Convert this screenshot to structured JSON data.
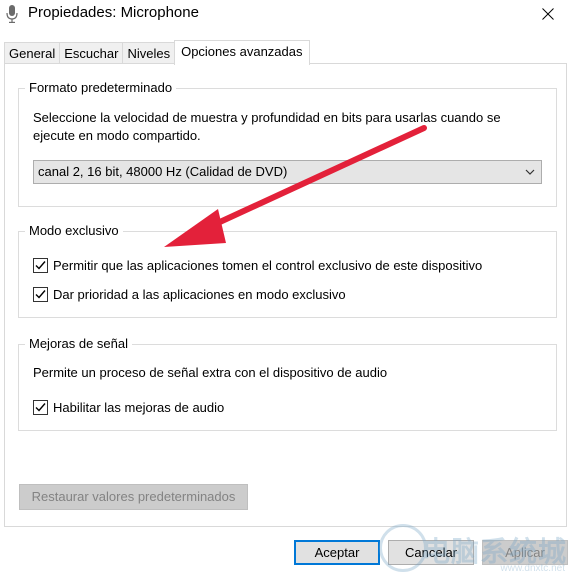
{
  "window": {
    "title": "Propiedades: Microphone",
    "icon": "microphone-icon",
    "close_icon": "close-icon"
  },
  "tabs": [
    {
      "label": "General",
      "active": false
    },
    {
      "label": "Escuchar",
      "active": false
    },
    {
      "label": "Niveles",
      "active": false
    },
    {
      "label": "Opciones avanzadas",
      "active": true
    }
  ],
  "default_format": {
    "legend": "Formato predeterminado",
    "description": "Seleccione la velocidad de muestra y profundidad en bits para usarlas cuando se ejecute en modo compartido.",
    "line1": "Seleccione la velocidad de muestra y profundidad en bits para usarlas cuando se",
    "line2": "ejecute en modo compartido.",
    "selected_value": "canal 2, 16 bit, 48000 Hz (Calidad de DVD)"
  },
  "exclusive_mode": {
    "legend": "Modo exclusivo",
    "options": [
      {
        "label": "Permitir que las aplicaciones tomen el control exclusivo de este dispositivo",
        "checked": true
      },
      {
        "label": "Dar prioridad a las aplicaciones en modo exclusivo",
        "checked": true
      }
    ]
  },
  "signal_enhancements": {
    "legend": "Mejoras de señal",
    "description": "Permite un proceso de señal extra con el dispositivo de audio",
    "option": {
      "label": "Habilitar las mejoras de audio",
      "checked": true
    }
  },
  "restore_button": "Restaurar valores predeterminados",
  "footer": {
    "accept": "Aceptar",
    "cancel": "Cancelar",
    "apply": "Aplicar"
  },
  "annotation": {
    "arrow_color": "#e3213a"
  },
  "watermark": {
    "text": "电脑系统城",
    "url": "www.dnxtc.net"
  },
  "colors": {
    "accent": "#0078d7",
    "border": "#d9d9d9"
  }
}
